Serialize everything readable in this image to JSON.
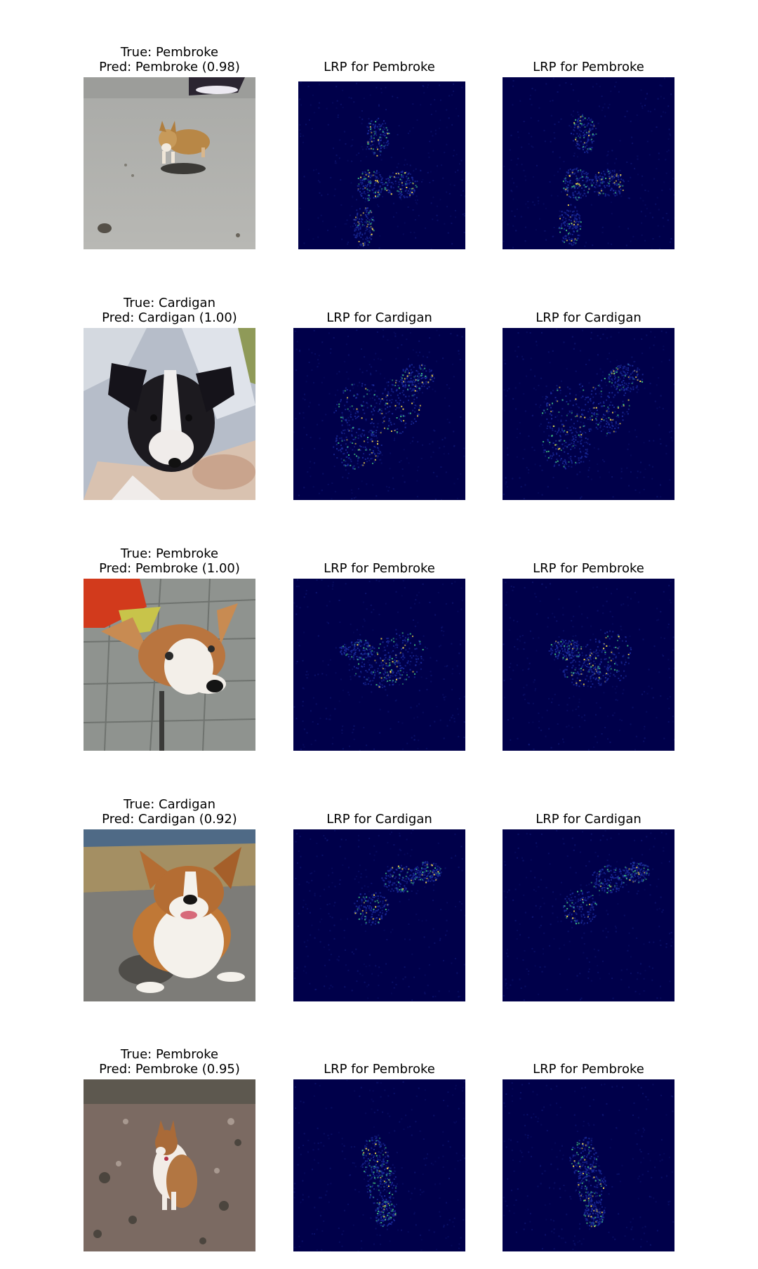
{
  "colors": {
    "heatmap_bg": "#00004a",
    "heatmap_mid": "#1a2a9a",
    "heatmap_hot": "#ffe24a",
    "heatmap_warm": "#3fbf7f"
  },
  "rows": [
    {
      "true_label": "True: Pembroke",
      "pred_label": "Pred: Pembroke (0.98)",
      "lrp_title_1": "LRP for Pembroke",
      "lrp_title_2": "LRP for Pembroke",
      "photo": "corgi-standing-on-pavement"
    },
    {
      "true_label": "True: Cardigan",
      "pred_label": "Pred: Cardigan (1.00)",
      "lrp_title_1": "LRP for Cardigan",
      "lrp_title_2": "LRP for Cardigan",
      "photo": "black-white-puppy-held-by-person"
    },
    {
      "true_label": "True: Pembroke",
      "pred_label": "Pred: Pembroke (1.00)",
      "lrp_title_1": "LRP for Pembroke",
      "lrp_title_2": "LRP for Pembroke",
      "photo": "corgi-head-closeup-on-tiles"
    },
    {
      "true_label": "True: Cardigan",
      "pred_label": "Pred: Cardigan (0.92)",
      "lrp_title_1": "LRP for Cardigan",
      "lrp_title_2": "LRP for Cardigan",
      "photo": "corgi-lying-on-gravel"
    },
    {
      "true_label": "True: Pembroke",
      "pred_label": "Pred: Pembroke (0.95)",
      "lrp_title_1": "LRP for Pembroke",
      "lrp_title_2": "LRP for Pembroke",
      "photo": "corgi-sitting-on-rocky-ground"
    }
  ]
}
